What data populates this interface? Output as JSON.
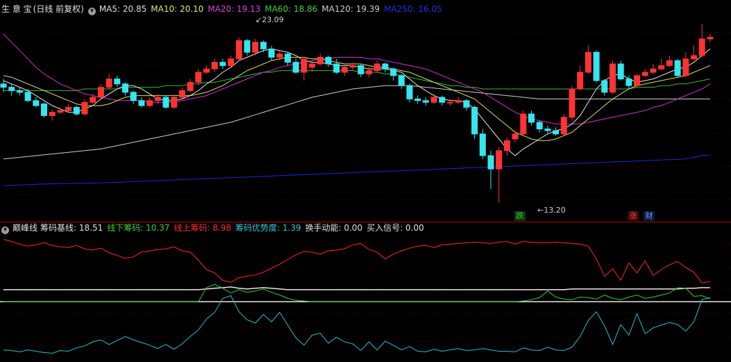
{
  "main_header": {
    "title": "生 意 宝",
    "mode": "(日线 前复权)",
    "ma": [
      {
        "label": "MA5: 20.85",
        "color": "#e0e0e0"
      },
      {
        "label": "MA10: 20.10",
        "color": "#e8e870"
      },
      {
        "label": "MA20: 19.13",
        "color": "#e040e0"
      },
      {
        "label": "MA60: 18.86",
        "color": "#40d040"
      },
      {
        "label": "MA120: 19.39",
        "color": "#d0d0d0"
      },
      {
        "label": "MA250: 16.05",
        "color": "#2030e0"
      }
    ]
  },
  "price_labels": {
    "high": "23.09",
    "low": "13.20"
  },
  "event_badges": [
    {
      "text": "跌",
      "color": "#40c040",
      "bg": "#0a3a0a"
    },
    {
      "text": "涨",
      "color": "#ff4040",
      "bg": "#3a0a0a"
    },
    {
      "text": "财",
      "color": "#60a0ff",
      "bg": "#0a1a3a"
    }
  ],
  "sub_header": {
    "name": "巅峰线",
    "items": [
      {
        "label": "筹码基线: 18.51",
        "color": "#e0e0e0"
      },
      {
        "label": "线下筹码: 10.37",
        "color": "#40d040"
      },
      {
        "label": "线上筹码: 8.98",
        "color": "#ff3030"
      },
      {
        "label": "筹码优势度: 1.39",
        "color": "#30c8d8"
      },
      {
        "label": "换手动能: 0.00",
        "color": "#e0e0e0"
      },
      {
        "label": "买入信号: 0.00",
        "color": "#e0e0e0"
      }
    ]
  },
  "colors": {
    "up": "#ff3333",
    "down": "#33e6f0",
    "divider": "#b00000",
    "grid": "#5a0000"
  },
  "chart_data": {
    "type": "candlestick",
    "candles": [
      [
        20.3,
        20.1,
        20.6,
        19.8
      ],
      [
        20.1,
        19.9,
        20.3,
        19.6
      ],
      [
        19.9,
        19.8,
        20.1,
        19.6
      ],
      [
        19.8,
        19.3,
        20.0,
        19.2
      ],
      [
        19.3,
        19.0,
        19.5,
        18.9
      ],
      [
        19.1,
        18.4,
        19.2,
        18.3
      ],
      [
        18.4,
        18.6,
        18.8,
        18.1
      ],
      [
        18.6,
        18.7,
        18.9,
        18.5
      ],
      [
        18.7,
        18.9,
        19.1,
        18.6
      ],
      [
        18.9,
        18.5,
        19.0,
        18.4
      ],
      [
        18.5,
        19.2,
        19.4,
        18.4
      ],
      [
        19.2,
        19.5,
        19.7,
        19.1
      ],
      [
        19.5,
        20.1,
        20.3,
        19.4
      ],
      [
        20.1,
        20.6,
        20.9,
        20.0
      ],
      [
        20.6,
        20.3,
        20.8,
        20.1
      ],
      [
        20.3,
        19.8,
        20.4,
        19.6
      ],
      [
        19.8,
        19.3,
        19.9,
        19.1
      ],
      [
        19.3,
        19.0,
        19.5,
        18.9
      ],
      [
        19.0,
        19.3,
        19.5,
        18.9
      ],
      [
        19.3,
        19.5,
        19.7,
        19.1
      ],
      [
        19.5,
        18.9,
        19.6,
        18.8
      ],
      [
        18.9,
        19.5,
        19.7,
        18.8
      ],
      [
        19.5,
        19.9,
        20.1,
        19.4
      ],
      [
        19.9,
        20.4,
        20.6,
        19.8
      ],
      [
        20.4,
        21.0,
        21.2,
        20.2
      ],
      [
        21.0,
        21.2,
        21.4,
        20.9
      ],
      [
        21.2,
        21.6,
        21.8,
        21.0
      ],
      [
        21.6,
        21.4,
        21.8,
        21.2
      ],
      [
        21.4,
        21.8,
        22.0,
        21.3
      ],
      [
        21.8,
        22.9,
        23.09,
        21.7
      ],
      [
        22.9,
        22.2,
        23.0,
        22.0
      ],
      [
        22.2,
        22.8,
        23.0,
        22.0
      ],
      [
        22.8,
        22.4,
        22.9,
        22.2
      ],
      [
        22.4,
        21.9,
        22.6,
        21.7
      ],
      [
        21.9,
        22.1,
        22.3,
        21.7
      ],
      [
        22.1,
        21.6,
        22.2,
        21.4
      ],
      [
        21.6,
        21.0,
        21.8,
        20.9
      ],
      [
        21.0,
        21.8,
        21.9,
        20.5
      ],
      [
        21.3,
        21.5,
        21.7,
        21.0
      ],
      [
        21.5,
        21.9,
        22.1,
        21.4
      ],
      [
        21.9,
        21.5,
        22.0,
        21.3
      ],
      [
        21.5,
        21.0,
        21.8,
        20.9
      ],
      [
        21.0,
        21.3,
        21.5,
        20.8
      ],
      [
        21.3,
        21.4,
        21.6,
        21.1
      ],
      [
        21.4,
        20.9,
        21.5,
        20.7
      ],
      [
        20.9,
        21.1,
        21.3,
        20.7
      ],
      [
        21.1,
        21.5,
        21.7,
        21.0
      ],
      [
        21.5,
        21.2,
        21.6,
        21.0
      ],
      [
        21.2,
        20.8,
        21.3,
        20.5
      ],
      [
        20.8,
        20.2,
        20.9,
        20.0
      ],
      [
        20.2,
        19.4,
        20.3,
        19.2
      ],
      [
        19.4,
        19.3,
        19.6,
        19.1
      ],
      [
        19.3,
        19.2,
        19.5,
        19.0
      ],
      [
        19.2,
        19.5,
        19.7,
        19.1
      ],
      [
        19.5,
        19.2,
        19.6,
        19.0
      ],
      [
        19.2,
        19.2,
        19.4,
        19.0
      ],
      [
        19.2,
        19.3,
        19.5,
        19.1
      ],
      [
        19.3,
        18.9,
        19.4,
        18.7
      ],
      [
        18.9,
        17.3,
        19.0,
        17.0
      ],
      [
        17.3,
        16.0,
        17.6,
        15.8
      ],
      [
        16.0,
        15.2,
        16.3,
        14.0
      ],
      [
        15.2,
        16.3,
        16.5,
        13.2
      ],
      [
        16.3,
        16.9,
        17.1,
        16.0
      ],
      [
        17.0,
        17.3,
        17.5,
        16.8
      ],
      [
        17.3,
        18.5,
        18.7,
        17.2
      ],
      [
        18.5,
        18.0,
        18.7,
        17.8
      ],
      [
        18.0,
        17.6,
        18.1,
        17.4
      ],
      [
        17.6,
        17.5,
        17.8,
        17.3
      ],
      [
        17.5,
        17.3,
        17.7,
        17.2
      ],
      [
        17.3,
        18.3,
        18.5,
        17.2
      ],
      [
        18.3,
        20.0,
        20.2,
        18.1
      ],
      [
        20.0,
        21.0,
        21.4,
        19.9
      ],
      [
        21.0,
        22.2,
        22.6,
        20.9
      ],
      [
        22.2,
        20.5,
        22.3,
        20.4
      ],
      [
        20.5,
        19.8,
        20.6,
        19.6
      ],
      [
        19.8,
        21.5,
        21.7,
        19.7
      ],
      [
        21.5,
        20.6,
        21.7,
        20.5
      ],
      [
        20.6,
        20.2,
        20.8,
        20.0
      ],
      [
        20.2,
        20.8,
        20.9,
        20.1
      ],
      [
        20.8,
        21.0,
        21.2,
        20.7
      ],
      [
        21.0,
        21.2,
        21.5,
        20.9
      ],
      [
        21.2,
        21.4,
        21.8,
        21.1
      ],
      [
        21.4,
        21.7,
        22.0,
        21.3
      ],
      [
        21.7,
        20.8,
        21.8,
        20.7
      ],
      [
        20.8,
        21.8,
        22.2,
        20.7
      ],
      [
        21.8,
        22.0,
        22.6,
        21.7
      ],
      [
        22.0,
        23.0,
        23.9,
        21.9
      ],
      [
        23.0,
        23.1,
        23.3,
        22.8
      ]
    ],
    "ma5": [
      20.5,
      20.3,
      20.1,
      19.9,
      19.6,
      19.3,
      19.0,
      18.8,
      18.6,
      18.6,
      18.8,
      19.0,
      19.4,
      19.7,
      20.0,
      20.2,
      20.2,
      20.0,
      19.7,
      19.4,
      19.3,
      19.3,
      19.4,
      19.6,
      19.9,
      20.3,
      20.6,
      21.0,
      21.3,
      21.7,
      21.9,
      22.1,
      22.3,
      22.4,
      22.3,
      22.2,
      22.0,
      21.7,
      21.6,
      21.6,
      21.5,
      21.4,
      21.4,
      21.4,
      21.3,
      21.2,
      21.2,
      21.2,
      21.1,
      21.0,
      20.6,
      20.2,
      19.9,
      19.6,
      19.4,
      19.3,
      19.3,
      19.2,
      18.8,
      18.2,
      17.6,
      17.0,
      16.4,
      16.0,
      16.4,
      16.7,
      17.0,
      17.3,
      17.5,
      17.6,
      17.9,
      18.4,
      19.2,
      20.0,
      20.5,
      20.8,
      20.9,
      20.6,
      20.4,
      20.5,
      20.6,
      20.8,
      21.0,
      21.2,
      21.3,
      21.6,
      22.0,
      22.4
    ],
    "ma10": [
      20.8,
      20.7,
      20.5,
      20.3,
      20.1,
      19.9,
      19.7,
      19.5,
      19.3,
      19.1,
      19.0,
      19.0,
      19.0,
      19.1,
      19.3,
      19.5,
      19.6,
      19.6,
      19.6,
      19.6,
      19.6,
      19.6,
      19.6,
      19.6,
      19.7,
      19.8,
      20.0,
      20.2,
      20.5,
      20.8,
      21.1,
      21.3,
      21.5,
      21.7,
      21.8,
      21.9,
      21.9,
      21.9,
      21.8,
      21.8,
      21.7,
      21.6,
      21.5,
      21.5,
      21.5,
      21.4,
      21.3,
      21.3,
      21.2,
      21.1,
      21.0,
      20.8,
      20.6,
      20.4,
      20.2,
      20.0,
      19.8,
      19.6,
      19.4,
      19.0,
      18.6,
      18.2,
      17.8,
      17.4,
      17.2,
      17.0,
      16.9,
      16.9,
      17.0,
      17.2,
      17.4,
      17.8,
      18.2,
      18.6,
      19.0,
      19.4,
      19.7,
      20.0,
      20.2,
      20.3,
      20.4,
      20.5,
      20.6,
      20.7,
      20.8,
      21.0,
      21.2,
      21.4
    ],
    "ma20": [
      23.3,
      22.8,
      22.3,
      21.8,
      21.3,
      20.9,
      20.6,
      20.3,
      20.1,
      19.9,
      19.7,
      19.6,
      19.5,
      19.4,
      19.3,
      19.3,
      19.3,
      19.3,
      19.2,
      19.2,
      19.2,
      19.2,
      19.3,
      19.4,
      19.5,
      19.6,
      19.8,
      20.0,
      20.2,
      20.4,
      20.6,
      20.8,
      21.0,
      21.1,
      21.3,
      21.4,
      21.5,
      21.6,
      21.7,
      21.8,
      21.8,
      21.9,
      21.9,
      21.9,
      21.9,
      21.8,
      21.8,
      21.7,
      21.6,
      21.5,
      21.4,
      21.3,
      21.2,
      21.0,
      20.8,
      20.6,
      20.4,
      20.2,
      20.0,
      19.8,
      19.5,
      19.2,
      18.9,
      18.6,
      18.4,
      18.2,
      18.1,
      18.0,
      17.9,
      17.9,
      17.9,
      17.9,
      18.0,
      18.1,
      18.2,
      18.3,
      18.4,
      18.5,
      18.6,
      18.7,
      18.9,
      19.0,
      19.2,
      19.4,
      19.6,
      19.8,
      20.0,
      20.3
    ],
    "ma60": [
      19.9,
      19.9,
      19.9,
      19.9,
      19.9,
      19.9,
      19.9,
      19.9,
      19.9,
      19.9,
      20.0,
      20.0,
      20.0,
      20.0,
      20.0,
      20.1,
      20.1,
      20.1,
      20.1,
      20.1,
      20.2,
      20.2,
      20.2,
      20.3,
      20.3,
      20.4,
      20.4,
      20.5,
      20.6,
      20.7,
      20.8,
      20.9,
      21.0,
      21.0,
      21.1,
      21.1,
      21.1,
      21.1,
      21.1,
      21.1,
      21.1,
      21.1,
      21.1,
      21.1,
      21.0,
      21.0,
      21.0,
      20.9,
      20.9,
      20.8,
      20.7,
      20.6,
      20.5,
      20.4,
      20.3,
      20.2,
      20.2,
      20.1,
      20.1,
      20.0,
      20.0,
      20.0,
      20.0,
      20.0,
      20.0,
      20.0,
      20.0,
      20.0,
      20.0,
      20.0,
      20.0,
      20.0,
      20.0,
      20.0,
      20.0,
      20.0,
      20.0,
      20.0,
      20.1,
      20.1,
      20.1,
      20.2,
      20.2,
      20.3,
      20.3,
      20.4,
      20.5,
      20.6
    ],
    "ma120": [
      15.8,
      15.85,
      15.9,
      15.95,
      16.0,
      16.05,
      16.1,
      16.15,
      16.2,
      16.25,
      16.3,
      16.35,
      16.4,
      16.5,
      16.6,
      16.7,
      16.8,
      16.9,
      17.0,
      17.1,
      17.2,
      17.3,
      17.4,
      17.5,
      17.6,
      17.7,
      17.8,
      17.9,
      18.0,
      18.15,
      18.3,
      18.45,
      18.6,
      18.75,
      18.9,
      19.05,
      19.2,
      19.35,
      19.5,
      19.6,
      19.7,
      19.8,
      19.9,
      20.0,
      20.05,
      20.1,
      20.15,
      20.2,
      20.2,
      20.2,
      20.2,
      20.15,
      20.1,
      20.05,
      20.0,
      19.95,
      19.9,
      19.85,
      19.8,
      19.75,
      19.7,
      19.65,
      19.6,
      19.55,
      19.5,
      19.45,
      19.4,
      19.4,
      19.4,
      19.4,
      19.4,
      19.4,
      19.4,
      19.4,
      19.4,
      19.4,
      19.4,
      19.4,
      19.4,
      19.4,
      19.4,
      19.4,
      19.4,
      19.4,
      19.4,
      19.4,
      19.4,
      19.4
    ],
    "ma250": [
      14.2,
      14.22,
      14.24,
      14.26,
      14.28,
      14.3,
      14.31,
      14.32,
      14.33,
      14.34,
      14.35,
      14.36,
      14.37,
      14.38,
      14.4,
      14.42,
      14.44,
      14.46,
      14.48,
      14.5,
      14.52,
      14.54,
      14.56,
      14.58,
      14.6,
      14.62,
      14.64,
      14.66,
      14.68,
      14.7,
      14.72,
      14.74,
      14.76,
      14.78,
      14.8,
      14.82,
      14.84,
      14.86,
      14.88,
      14.9,
      14.92,
      14.94,
      14.96,
      14.98,
      15.0,
      15.02,
      15.04,
      15.06,
      15.08,
      15.1,
      15.12,
      15.14,
      15.16,
      15.18,
      15.2,
      15.22,
      15.24,
      15.26,
      15.28,
      15.3,
      15.32,
      15.34,
      15.36,
      15.38,
      15.4,
      15.42,
      15.44,
      15.46,
      15.48,
      15.5,
      15.52,
      15.54,
      15.56,
      15.58,
      15.6,
      15.62,
      15.64,
      15.66,
      15.68,
      15.7,
      15.72,
      15.74,
      15.76,
      15.78,
      15.8,
      15.9,
      16.0,
      16.05
    ],
    "sub_red": [
      9.5,
      9.2,
      8.8,
      8.5,
      8.7,
      9.0,
      8.6,
      8.4,
      8.3,
      8.6,
      8.1,
      7.9,
      8.2,
      7.5,
      7.1,
      6.7,
      6.9,
      7.6,
      7.8,
      8.0,
      8.1,
      8.4,
      7.8,
      7.6,
      6.4,
      5.0,
      4.5,
      3.4,
      3.1,
      3.8,
      4.0,
      4.2,
      4.6,
      5.2,
      5.8,
      6.5,
      7.2,
      7.7,
      7.6,
      7.3,
      7.8,
      7.9,
      8.1,
      8.7,
      8.9,
      8.0,
      7.6,
      6.6,
      7.3,
      7.8,
      8.2,
      8.5,
      8.6,
      8.3,
      8.7,
      8.8,
      8.9,
      9.0,
      9.1,
      9.0,
      8.9,
      9.1,
      9.2,
      8.8,
      9.2,
      9.1,
      9.0,
      9.0,
      9.1,
      9.0,
      8.9,
      8.8,
      8.5,
      6.6,
      4.0,
      5.1,
      3.4,
      6.0,
      4.5,
      6.3,
      4.1,
      5.0,
      5.7,
      6.2,
      5.3,
      4.6,
      3.0,
      3.2
    ],
    "sub_white": [
      2.0,
      2.0,
      2.0,
      2.0,
      2.0,
      2.0,
      2.0,
      2.0,
      2.0,
      2.0,
      2.0,
      2.0,
      2.0,
      2.0,
      2.0,
      2.0,
      2.0,
      2.0,
      2.0,
      2.0,
      2.0,
      2.0,
      2.0,
      2.0,
      2.0,
      2.1,
      2.2,
      2.3,
      2.4,
      2.2,
      2.1,
      2.2,
      2.3,
      2.2,
      2.1,
      2.0,
      2.0,
      2.0,
      2.0,
      2.0,
      2.0,
      2.0,
      2.0,
      2.0,
      2.0,
      2.0,
      2.0,
      2.0,
      2.0,
      2.0,
      2.0,
      2.0,
      2.0,
      2.0,
      2.0,
      2.0,
      2.0,
      2.0,
      2.0,
      2.0,
      2.0,
      2.0,
      2.0,
      2.0,
      2.0,
      2.0,
      2.0,
      2.0,
      2.0,
      2.0,
      2.1,
      2.1,
      2.1,
      2.1,
      2.1,
      2.1,
      2.1,
      2.1,
      2.1,
      2.1,
      2.1,
      2.1,
      2.1,
      2.1,
      2.2,
      2.2,
      2.3,
      2.3
    ],
    "sub_green": [
      0.2,
      0.2,
      0.2,
      0.2,
      0.2,
      0.2,
      0.2,
      0.2,
      0.2,
      0.2,
      0.2,
      0.2,
      0.2,
      0.2,
      0.2,
      0.2,
      0.2,
      0.2,
      0.2,
      0.2,
      0.2,
      0.2,
      0.2,
      0.2,
      0.2,
      2.3,
      2.8,
      2.2,
      1.5,
      2.0,
      1.6,
      1.8,
      2.1,
      1.6,
      1.2,
      0.7,
      0.4,
      0.3,
      0.2,
      0.2,
      0.2,
      0.2,
      0.2,
      0.2,
      0.2,
      0.2,
      0.2,
      0.2,
      0.2,
      0.2,
      0.2,
      0.2,
      0.2,
      0.2,
      0.2,
      0.2,
      0.2,
      0.2,
      0.2,
      0.2,
      0.2,
      0.2,
      0.2,
      0.2,
      0.3,
      0.5,
      0.8,
      1.8,
      0.9,
      0.6,
      0.5,
      0.9,
      0.8,
      0.6,
      1.2,
      0.7,
      0.5,
      0.9,
      1.2,
      0.7,
      0.9,
      1.2,
      1.5,
      2.3,
      2.2,
      1.0,
      1.1,
      0.6
    ],
    "sub_cyan": [
      -7.0,
      -7.1,
      -7.3,
      -7.0,
      -7.2,
      -7.4,
      -7.5,
      -7.1,
      -7.2,
      -6.7,
      -6.4,
      -5.8,
      -5.5,
      -6.2,
      -5.6,
      -5.0,
      -5.5,
      -5.9,
      -6.3,
      -6.8,
      -6.2,
      -6.9,
      -6.1,
      -5.0,
      -4.0,
      -2.4,
      -1.4,
      0.7,
      1.1,
      -1.3,
      -2.5,
      -3.0,
      -1.7,
      -2.8,
      -1.4,
      -3.3,
      -5.2,
      -6.3,
      -4.8,
      -4.5,
      -6.0,
      -5.1,
      -5.8,
      -6.1,
      -7.1,
      -5.8,
      -7.0,
      -5.7,
      -6.3,
      -7.0,
      -6.5,
      -7.2,
      -7.3,
      -6.9,
      -7.2,
      -7.0,
      -6.8,
      -7.1,
      -7.0,
      -6.8,
      -7.0,
      -7.2,
      -7.2,
      -7.3,
      -6.7,
      -7.0,
      -7.1,
      -6.6,
      -7.0,
      -7.1,
      -6.6,
      -5.0,
      -2.6,
      -1.3,
      -3.4,
      -6.2,
      -3.2,
      -4.8,
      -1.6,
      -4.6,
      -3.7,
      -3.3,
      -2.9,
      -3.2,
      -4.2,
      -2.8,
      0.5,
      0.8
    ]
  }
}
